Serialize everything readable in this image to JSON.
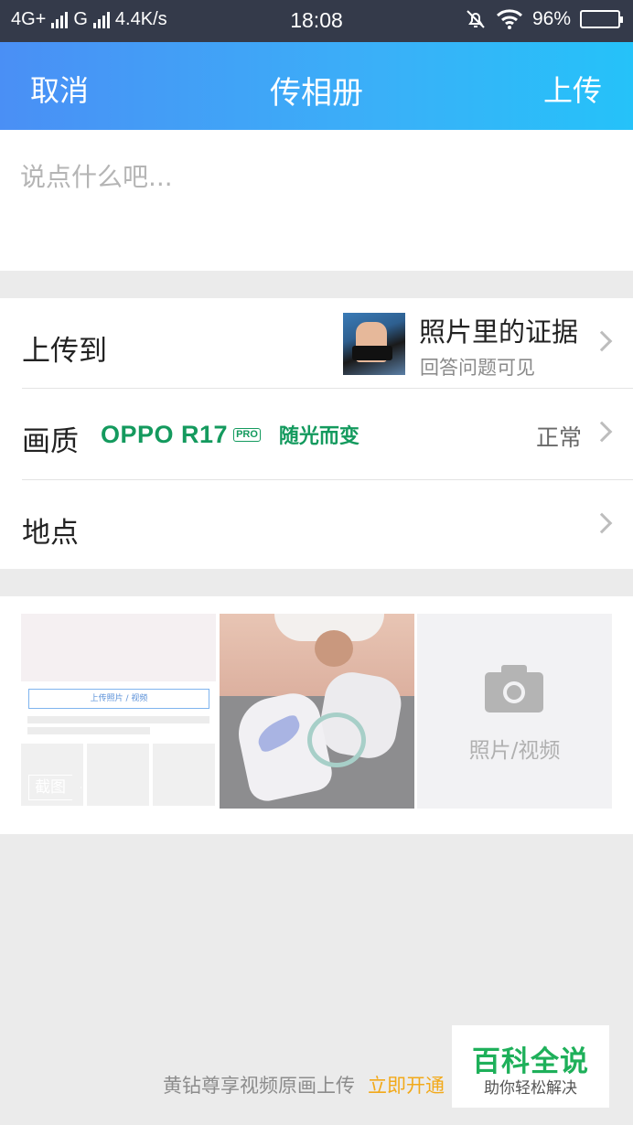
{
  "status_bar": {
    "network": "4G+",
    "network2": "G",
    "speed": "4.4K/s",
    "time": "18:08",
    "battery": "96%",
    "icons": [
      "signal-icon",
      "mute-bell-icon",
      "wifi-icon",
      "battery-icon"
    ]
  },
  "nav": {
    "cancel_label": "取消",
    "title": "传相册",
    "upload_label": "上传"
  },
  "compose": {
    "placeholder": "说点什么吧...",
    "value": ""
  },
  "settings": {
    "upload_to": {
      "label": "上传到",
      "album_name": "照片里的证据",
      "album_visibility": "回答问题可见"
    },
    "quality": {
      "label": "画质",
      "brand_model": "OPPO R17",
      "brand_badge": "PRO",
      "brand_slogan": "随光而变",
      "value": "正常"
    },
    "location": {
      "label": "地点"
    }
  },
  "media": {
    "screenshot_tile": {
      "inner_button": "上传照片 / 视频",
      "tag": "截图"
    },
    "add_tile": {
      "label": "照片/视频",
      "icon": "camera-icon"
    }
  },
  "footer": {
    "note": "黄钻尊享视频原画上传",
    "link": "立即开通"
  },
  "watermark": {
    "title": "百科全说",
    "subtitle": "助你轻松解决"
  },
  "colors": {
    "nav_gradient_start": "#4a8ff5",
    "nav_gradient_end": "#25c2f9",
    "brand_green": "#149a5e",
    "link_orange": "#f2a91a"
  }
}
